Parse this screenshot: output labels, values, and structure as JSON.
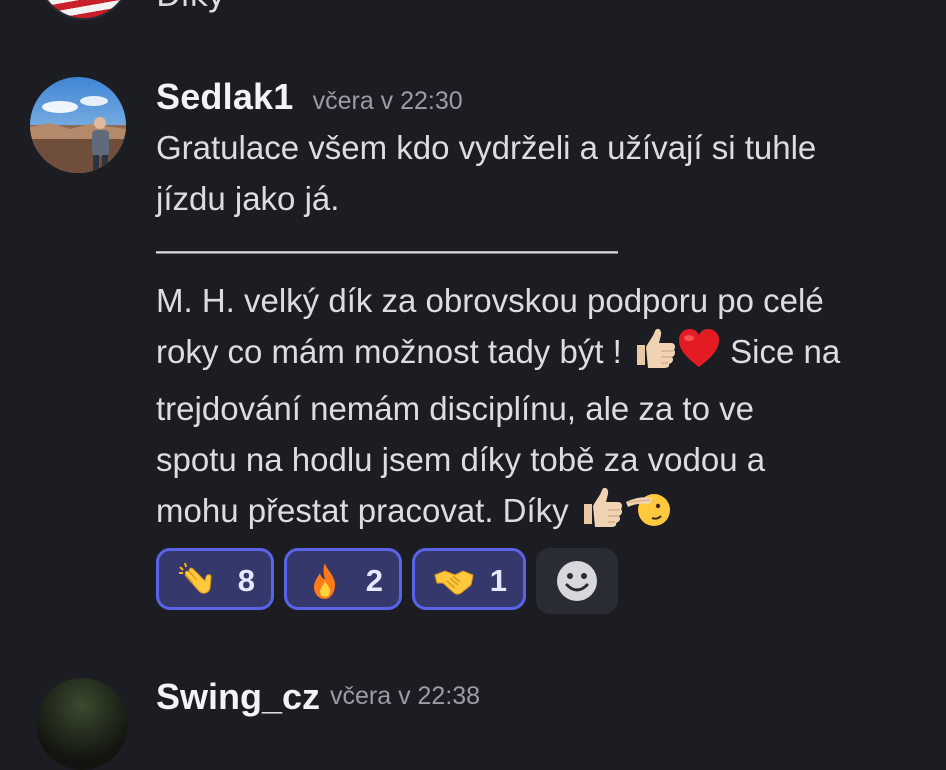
{
  "previous_message": {
    "text": "Díky"
  },
  "message": {
    "username": "Sedlak1",
    "timestamp": "včera v 22:30",
    "lines": [
      "Gratulace všem kdo vydrželi a užívají si tuhle",
      "jízdu jako já.",
      "——————————————",
      "M. H. velký dík za obrovskou podporu po celé",
      "roky co mám možnost tady být !",
      "Sice na",
      "trejdování nemám disciplínu, ale za to ve",
      "spotu na hodlu jsem díky tobě za vodou a",
      "mohu přestat pracovat. Díky"
    ],
    "inline_emojis": [
      "thumbs-up-emoji",
      "red-heart-emoji",
      "thumbs-up-emoji",
      "saluting-face-emoji"
    ]
  },
  "reactions": [
    {
      "emoji": "clapping-hands",
      "count": "8"
    },
    {
      "emoji": "fire",
      "count": "2"
    },
    {
      "emoji": "handshake",
      "count": "1"
    }
  ],
  "next_message": {
    "username": "Swing_cz",
    "timestamp": "včera v 22:38"
  }
}
